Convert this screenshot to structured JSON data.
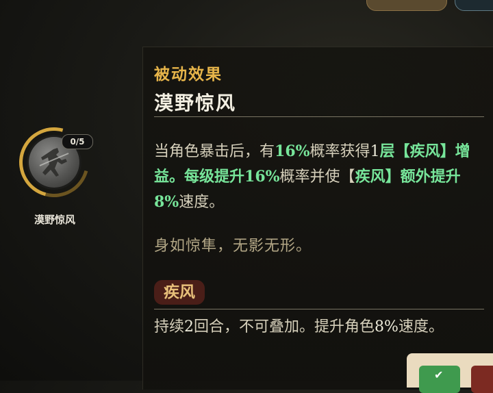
{
  "skill_node": {
    "level": "0/5",
    "name": "漠野惊风",
    "icon": "wind-swordsman-icon"
  },
  "panel": {
    "section_label": "被动效果",
    "title": "漠野惊风",
    "desc": {
      "p1": "当角色暴击后，有",
      "v1": "16%",
      "p2": "概率获得",
      "v2": "1",
      "p3": "层【",
      "k1": "疾风",
      "p4": "】增益。每级提升",
      "v3": "16%",
      "p5": "概率并使【",
      "k2": "疾风",
      "p6": "】额外提升",
      "v4": "8%",
      "p7": "速度。"
    },
    "flavor": "身如惊隼，无影无形。",
    "buff": {
      "tag": "疾风",
      "d1": "持续",
      "d2": "2",
      "d3": "回合，不可叠加。提升角色",
      "d4": "8%",
      "d5": "速度。"
    }
  },
  "colors": {
    "gold": "#e7b54a",
    "highlight_green": "#77e59a",
    "buff_tag_bg": "#4a1e18"
  }
}
